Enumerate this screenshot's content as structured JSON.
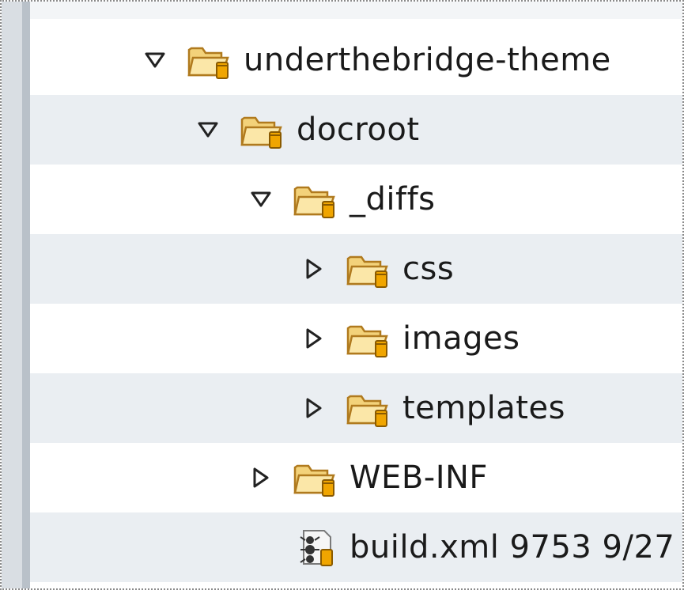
{
  "tree": {
    "rows": [
      {
        "label": "underthebridge-theme",
        "kind": "folder",
        "expanded": true,
        "depth": 0,
        "alt": false
      },
      {
        "label": "docroot",
        "kind": "folder",
        "expanded": true,
        "depth": 1,
        "alt": true
      },
      {
        "label": "_diffs",
        "kind": "folder",
        "expanded": true,
        "depth": 2,
        "alt": false
      },
      {
        "label": "css",
        "kind": "folder",
        "expanded": false,
        "depth": 3,
        "alt": true
      },
      {
        "label": "images",
        "kind": "folder",
        "expanded": false,
        "depth": 3,
        "alt": false
      },
      {
        "label": "templates",
        "kind": "folder",
        "expanded": false,
        "depth": 3,
        "alt": true
      },
      {
        "label": "WEB-INF",
        "kind": "folder",
        "expanded": false,
        "depth": 2,
        "alt": false
      },
      {
        "label": "build.xml 9753  9/27",
        "kind": "ant-file",
        "expanded": null,
        "depth": 2,
        "alt": true
      }
    ]
  },
  "icons": {
    "folder": "folder-open-icon",
    "ant_file": "ant-build-file-icon",
    "expanded": "triangle-down-icon",
    "collapsed": "triangle-right-icon"
  },
  "colors": {
    "folder_fill": "#f3d27a",
    "folder_stroke": "#b07a1e",
    "jar_fill": "#f0a500",
    "alt_row": "#eaeef2"
  }
}
